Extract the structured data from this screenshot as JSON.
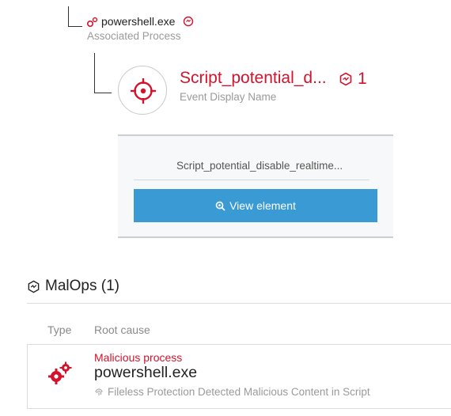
{
  "colors": {
    "accent_red": "#d3132c",
    "button_blue": "#3a9bd4",
    "muted_text": "#9a9a9a"
  },
  "process": {
    "name": "powershell.exe",
    "subtitle": "Associated Process",
    "icon": "gears-icon",
    "badge_icon": "malicious-badge-icon"
  },
  "event": {
    "name": "Script_potential_d...",
    "subtitle": "Event Display Name",
    "icon": "crosshair-target-icon",
    "malop_icon": "malop-hexagon-icon",
    "malop_count": "1"
  },
  "panel": {
    "full_name": "Script_potential_disable_realtime...",
    "button_label": "View element",
    "button_icon": "magnifier-icon"
  },
  "malops": {
    "title": "MalOps (1)",
    "icon": "malop-hexagon-icon",
    "columns": [
      "Type",
      "Root cause"
    ],
    "rows": [
      {
        "type_icon": "gears-icon",
        "category": "Malicious process",
        "root_cause": "powershell.exe",
        "description_icon": "fingerprint-icon",
        "description": "Fileless Protection Detected Malicious Content in Script"
      }
    ]
  }
}
